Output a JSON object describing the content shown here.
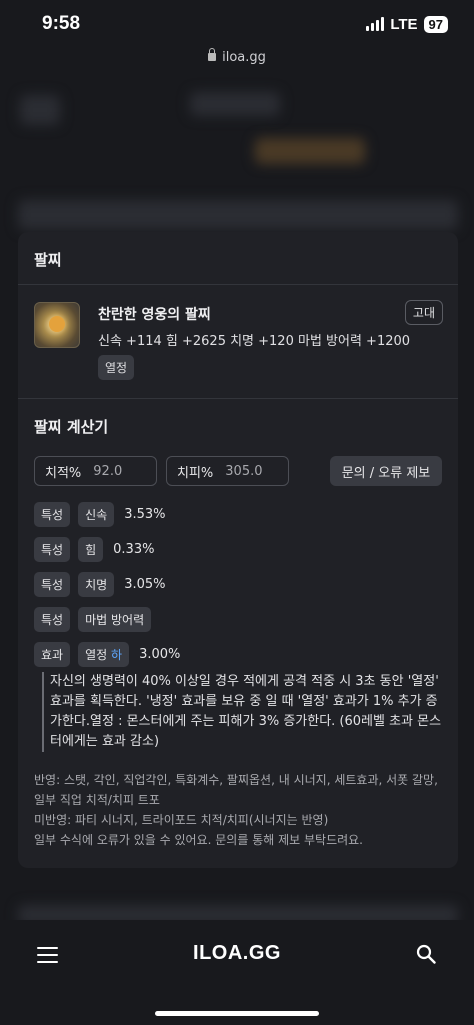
{
  "status_bar": {
    "time": "9:58",
    "network": "LTE",
    "battery": "97"
  },
  "browser": {
    "url": "iloa.gg"
  },
  "bracelet": {
    "section_title": "팔찌",
    "item_name": "찬란한 영웅의 팔찌",
    "grade": "고대",
    "stats": "신속 +114  힘 +2625  치명 +120  마법 방어력 +1200",
    "tag": "열정"
  },
  "calculator": {
    "title": "팔찌 계산기",
    "crit_rate_label": "치적%",
    "crit_rate_value": "92.0",
    "crit_dmg_label": "치피%",
    "crit_dmg_value": "305.0",
    "report_button": "문의 / 오류 제보",
    "rows": [
      {
        "type": "특성",
        "name": "신속",
        "value": "3.53%"
      },
      {
        "type": "특성",
        "name": "힘",
        "value": "0.33%"
      },
      {
        "type": "특성",
        "name": "치명",
        "value": "3.05%"
      },
      {
        "type": "특성",
        "name": "마법 방어력",
        "value": ""
      }
    ],
    "effect": {
      "type": "효과",
      "name": "열정",
      "grade": "하",
      "value": "3.00%"
    },
    "effect_description": "자신의 생명력이 40% 이상일 경우 적에게 공격 적중 시 3초 동안 '열정' 효과를 획득한다. '냉정' 효과를 보유 중 일 때 '열정' 효과가 1% 추가 증가한다.열정 : 몬스터에게 주는 피해가 3% 증가한다. (60레벨 초과 몬스터에게는 효과 감소)",
    "notes": [
      "반영: 스탯, 각인, 직업각인, 특화계수, 팔찌옵션, 내 시너지, 세트효과, 서폿 갈망, 일부 직업 치적/치피 트포",
      "미반영: 파티 시너지, 트라이포드 치적/치피(시너지는 반영)",
      "일부 수식에 오류가 있을 수 있어요. 문의를 통해 제보 부탁드려요."
    ]
  },
  "bottom_nav": {
    "logo": "ILOA.GG"
  },
  "colors": {
    "background": "#18191d",
    "panel": "#202126",
    "chip": "#393b42",
    "highlight": "#5fa8ff"
  },
  "icons": [
    "lock-icon",
    "bracelet-item-icon",
    "menu-icon",
    "search-icon"
  ]
}
